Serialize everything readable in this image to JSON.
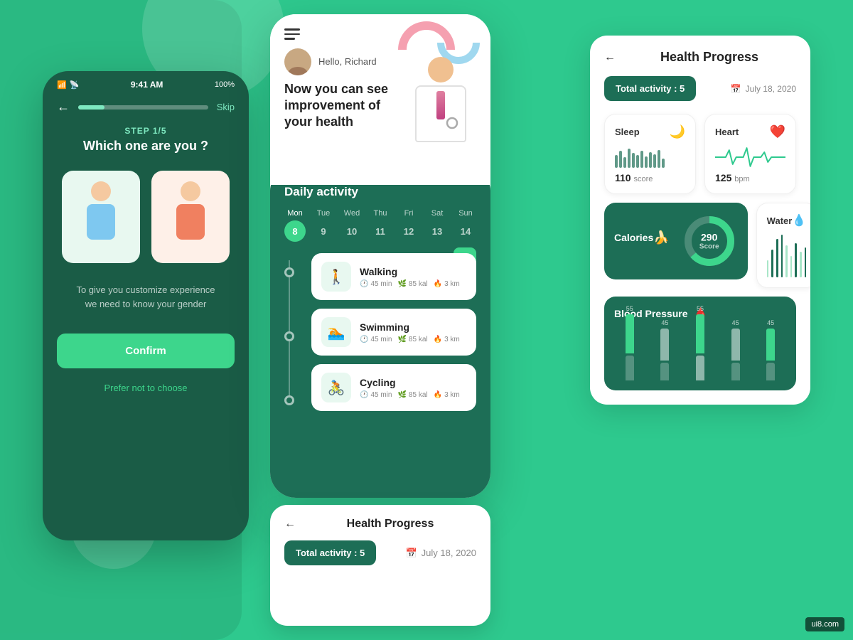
{
  "bg": {
    "color": "#2ec98e"
  },
  "phone1": {
    "status_bar": {
      "signal": "📶",
      "wifi": "📡",
      "time": "9:41 AM",
      "battery": "100%"
    },
    "step": "STEP 1/5",
    "question": "Which one are you ?",
    "subtext_line1": "To give you customize experience",
    "subtext_line2": "we need to know your gender",
    "confirm_label": "Confirm",
    "prefer_label": "Prefer not to choose",
    "skip_label": "Skip"
  },
  "phone2": {
    "greeting": "Hello, Richard",
    "subtitle": "Now you can see improvement of your health",
    "daily_title": "Daily activity",
    "days": [
      {
        "name": "Mon",
        "num": "8",
        "active": true
      },
      {
        "name": "Tue",
        "num": "9",
        "active": false
      },
      {
        "name": "Wed",
        "num": "10",
        "active": false
      },
      {
        "name": "Thu",
        "num": "11",
        "active": false
      },
      {
        "name": "Fri",
        "num": "12",
        "active": false
      },
      {
        "name": "Sat",
        "num": "13",
        "active": false
      },
      {
        "name": "Sun",
        "num": "14",
        "active": false
      }
    ],
    "activities": [
      {
        "icon": "🚶",
        "name": "Walking",
        "min": "45 min",
        "kal": "85 kal",
        "km": "3 km"
      },
      {
        "icon": "🏊",
        "name": "Swimming",
        "min": "45 min",
        "kal": "85 kal",
        "km": "3 km"
      },
      {
        "icon": "🚴",
        "name": "Cycling",
        "min": "45 min",
        "kal": "85 kal",
        "km": "3 km"
      }
    ]
  },
  "health_progress_small": {
    "back": "←",
    "title": "Health Progress",
    "total_label": "Total activity : 5",
    "date": "July 18, 2020"
  },
  "health_panel": {
    "back": "←",
    "title": "Health Progress",
    "total_label": "Total activity : 5",
    "date": "July 18, 2020",
    "sleep": {
      "name": "Sleep",
      "icon": "🌙",
      "value": "110",
      "unit": "score"
    },
    "heart": {
      "name": "Heart",
      "icon": "❤️",
      "value": "125",
      "unit": "bpm"
    },
    "calories": {
      "name": "Calories",
      "icon": "🍌",
      "value": "290",
      "unit": "Score"
    },
    "water": {
      "name": "Water",
      "icon": "💧",
      "bars": [
        30,
        50,
        70,
        90,
        60,
        40,
        80,
        55,
        65
      ]
    },
    "blood_pressure": {
      "name": "Blood Pressure",
      "icon": "🩸",
      "data": [
        {
          "label": "55",
          "h1": 55,
          "h2": 35
        },
        {
          "label": "45",
          "h1": 45,
          "h2": 25
        },
        {
          "label": "55",
          "h1": 55,
          "h2": 35
        },
        {
          "label": "45",
          "h1": 45,
          "h2": 25
        },
        {
          "label": "45",
          "h1": 45,
          "h2": 25
        }
      ]
    }
  },
  "watermark": "ui8.com"
}
